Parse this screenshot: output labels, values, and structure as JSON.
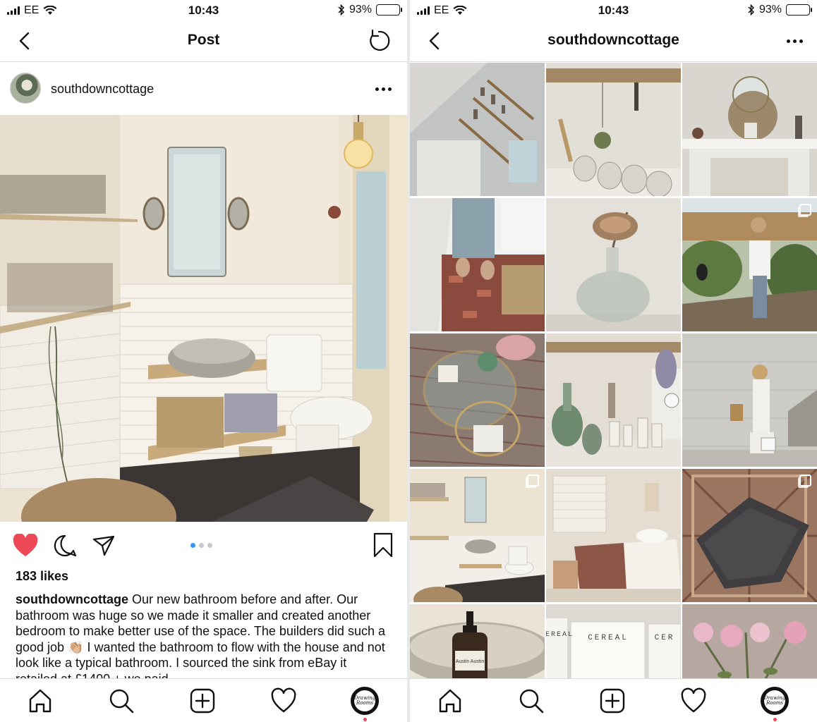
{
  "status": {
    "carrier": "EE",
    "time": "10:43",
    "battery": "93%",
    "battery_level": 0.93
  },
  "post_screen": {
    "title": "Post",
    "author": "southdowncottage",
    "likes": "183 likes",
    "caption_user": "southdowncottage",
    "caption_text": " Our new bathroom before and after. Our bathroom was huge so we made it smaller and created another bedroom to make better use of the space. The builders did such a good job 👏🏼 I wanted the bathroom to flow with the house and not look like a typical bathroom. I sourced the sink from eBay it retailed at £1400 + we paid",
    "carousel": {
      "count": 3,
      "active": 1
    },
    "liked": true
  },
  "profile_screen": {
    "title": "southdowncottage",
    "grid": [
      {
        "subject": "kitchen-shelves",
        "multi": false
      },
      {
        "subject": "mugs-and-plant",
        "multi": false
      },
      {
        "subject": "fireplace-dried-flowers",
        "multi": false
      },
      {
        "subject": "feet-on-rug",
        "multi": false
      },
      {
        "subject": "protea-in-vase",
        "multi": false
      },
      {
        "subject": "woman-with-dog",
        "multi": true
      },
      {
        "subject": "glass-table",
        "multi": false
      },
      {
        "subject": "bottles-on-sill",
        "multi": false
      },
      {
        "subject": "woman-against-wall",
        "multi": false
      },
      {
        "subject": "bathroom",
        "multi": true
      },
      {
        "subject": "bedroom",
        "multi": false
      },
      {
        "subject": "grey-throw-on-rug",
        "multi": true
      },
      {
        "subject": "soap-bottle",
        "multi": false
      },
      {
        "subject": "cereal-magazines",
        "multi": false
      },
      {
        "subject": "peonies",
        "multi": false
      }
    ],
    "grid_text": {
      "bottle_label": "Austin Austin",
      "magazine_1": "CEREAL",
      "magazine_2": "CEREAL",
      "magazine_3": "CER"
    }
  },
  "tabbar": {
    "profile_badge": "Drawing Rooms"
  },
  "colors": {
    "like_red": "#ed4956",
    "accent_blue": "#3897f0",
    "border": "#dbdbdb"
  }
}
